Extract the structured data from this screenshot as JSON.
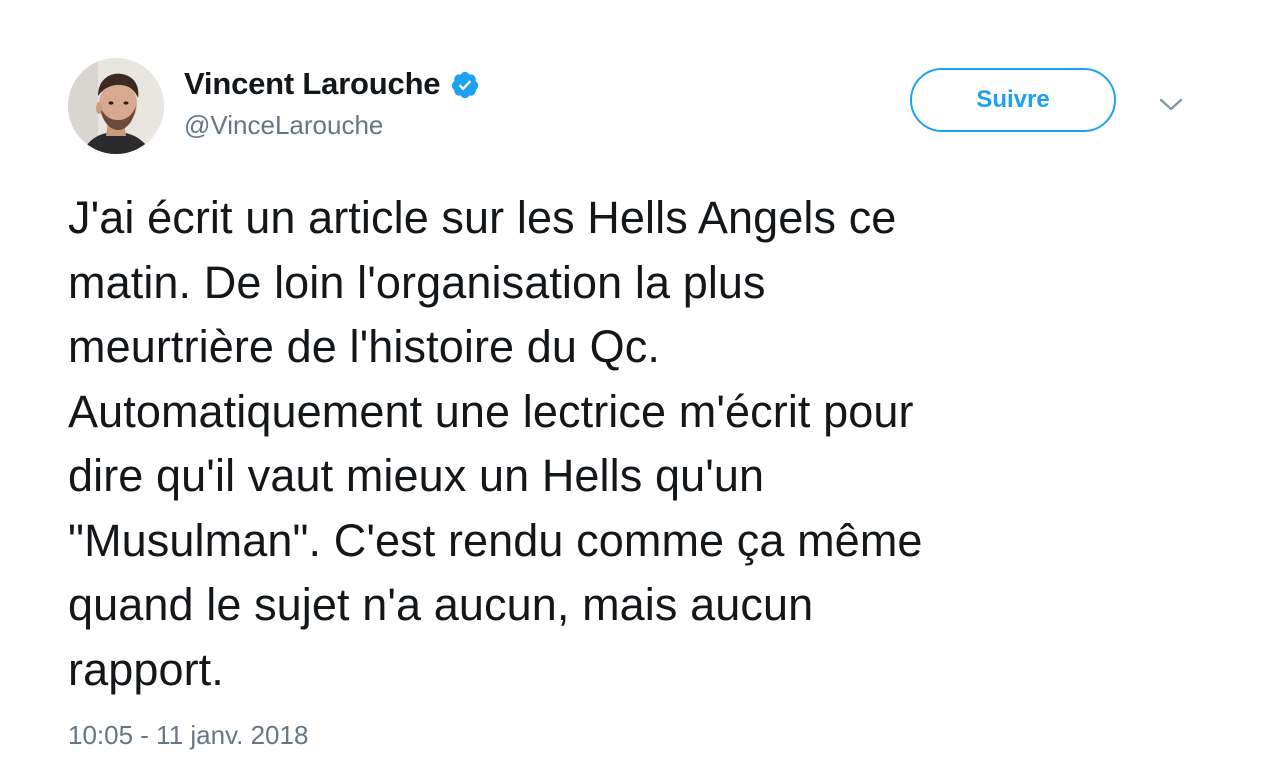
{
  "author": {
    "display_name": "Vincent Larouche",
    "handle": "@VinceLarouche",
    "verified": true,
    "avatar_icon": "user-avatar-photo"
  },
  "actions": {
    "follow_label": "Suivre",
    "menu_icon": "chevron-down-icon"
  },
  "tweet": {
    "text": "J'ai écrit un article sur les Hells Angels ce\nmatin. De loin l'organisation la plus\nmeurtrière de l'histoire du Qc.\nAutomatiquement une lectrice m'écrit pour\ndire qu'il vaut mieux un Hells qu'un\n\"Musulman\". C'est rendu comme ça même\nquand le sujet n'a aucun, mais aucun\nrapport.",
    "timestamp": "10:05 - 11 janv. 2018"
  },
  "colors": {
    "accent": "#1da1f2",
    "text_primary": "#14171a",
    "text_secondary": "#657786",
    "caret": "#8899a6"
  }
}
